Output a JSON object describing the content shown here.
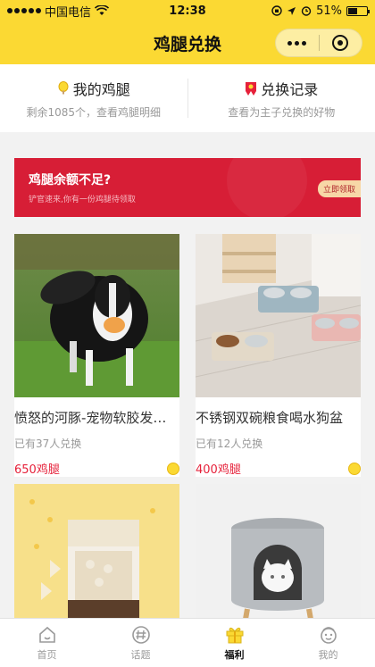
{
  "status_bar": {
    "carrier": "中国电信",
    "time": "12:38",
    "battery": "51%",
    "battery_level": 0.51
  },
  "nav": {
    "title": "鸡腿兑换"
  },
  "quick": {
    "left": {
      "title": "我的鸡腿",
      "subtitle": "剩余1085个，查看鸡腿明细"
    },
    "right": {
      "title": "兑换记录",
      "subtitle": "查看为主子兑换的好物"
    }
  },
  "banner": {
    "title": "鸡腿余额不足?",
    "subtitle": "铲官速来,你有一份鸡腿待领取",
    "button": "立即领取"
  },
  "products": [
    {
      "name": "愤怒的河豚-宠物软胶发声玩具",
      "sold": "已有37人兑换",
      "price": "650鸡腿"
    },
    {
      "name": "不锈钢双碗粮食喝水狗盆",
      "sold": "已有12人兑换",
      "price": "400鸡腿"
    },
    {
      "name": "",
      "sold": "",
      "price": ""
    },
    {
      "name": "",
      "sold": "",
      "price": ""
    }
  ],
  "tabs": [
    {
      "label": "首页",
      "icon": "home-icon"
    },
    {
      "label": "话题",
      "icon": "topic-hash-icon"
    },
    {
      "label": "福利",
      "icon": "gift-icon",
      "active": true
    },
    {
      "label": "我的",
      "icon": "face-icon"
    }
  ],
  "colors": {
    "brand_yellow": "#fbd933",
    "banner_red": "#d71e36",
    "price_red": "#e6213a"
  }
}
